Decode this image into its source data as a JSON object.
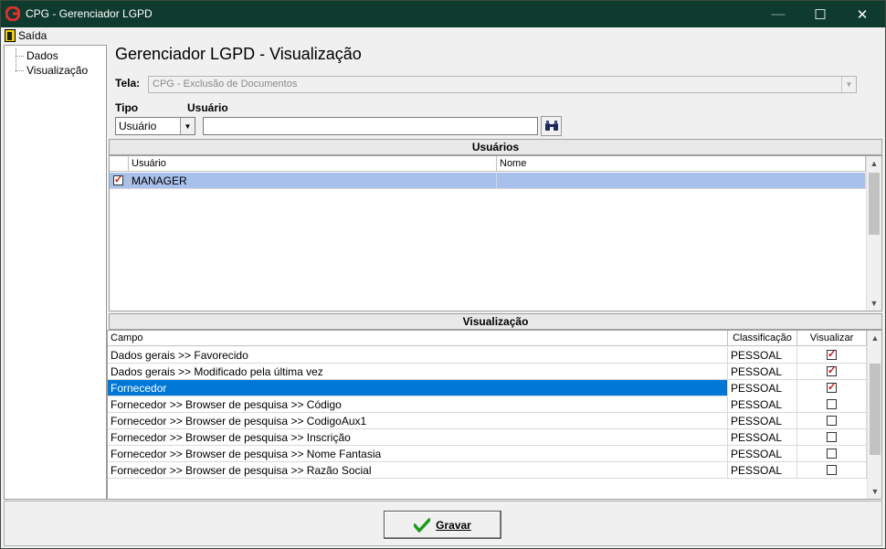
{
  "window": {
    "title": "CPG - Gerenciador LGPD",
    "minimize": "—",
    "maximize": "☐",
    "close": "✕"
  },
  "menu": {
    "exit_label": "Saída"
  },
  "tree": {
    "items": [
      "Dados",
      "Visualização"
    ]
  },
  "page_title": "Gerenciador LGPD - Visualização",
  "tela": {
    "label": "Tela:",
    "value": "CPG - Exclusão de Documentos"
  },
  "filter": {
    "tipo_label": "Tipo",
    "usuario_label": "Usuário",
    "tipo_value": "Usuário",
    "usuario_value": ""
  },
  "users_panel": {
    "title": "Usuários",
    "columns": [
      "Usuário",
      "Nome"
    ],
    "rows": [
      {
        "checked": true,
        "usuario": "MANAGER",
        "nome": ""
      }
    ]
  },
  "view_panel": {
    "title": "Visualização",
    "columns": [
      "Campo",
      "Classificação",
      "Visualizar"
    ],
    "rows": [
      {
        "campo": "Dados gerais >> Favorecido",
        "classificacao": "PESSOAL",
        "visualizar": true
      },
      {
        "campo": "Dados gerais >> Modificado pela última vez",
        "classificacao": "PESSOAL",
        "visualizar": true
      },
      {
        "campo": "Fornecedor",
        "classificacao": "PESSOAL",
        "visualizar": true
      },
      {
        "campo": "Fornecedor >> Browser de pesquisa >> Código",
        "classificacao": "PESSOAL",
        "visualizar": false
      },
      {
        "campo": "Fornecedor >> Browser de pesquisa >> CodigoAux1",
        "classificacao": "PESSOAL",
        "visualizar": false
      },
      {
        "campo": "Fornecedor >> Browser de pesquisa >> Inscrição",
        "classificacao": "PESSOAL",
        "visualizar": false
      },
      {
        "campo": "Fornecedor >> Browser de pesquisa >> Nome Fantasia",
        "classificacao": "PESSOAL",
        "visualizar": false
      },
      {
        "campo": "Fornecedor >> Browser de pesquisa >> Razão Social",
        "classificacao": "PESSOAL",
        "visualizar": false
      }
    ],
    "selected_row": 2
  },
  "actions": {
    "save_label": "Gravar"
  },
  "colors": {
    "titlebar": "#0f3b2e",
    "user_row_selected": "#a8c0ec",
    "view_row_selected": "#0078d7",
    "check_mark": "#d01010",
    "save_check": "#1f9a1f"
  }
}
